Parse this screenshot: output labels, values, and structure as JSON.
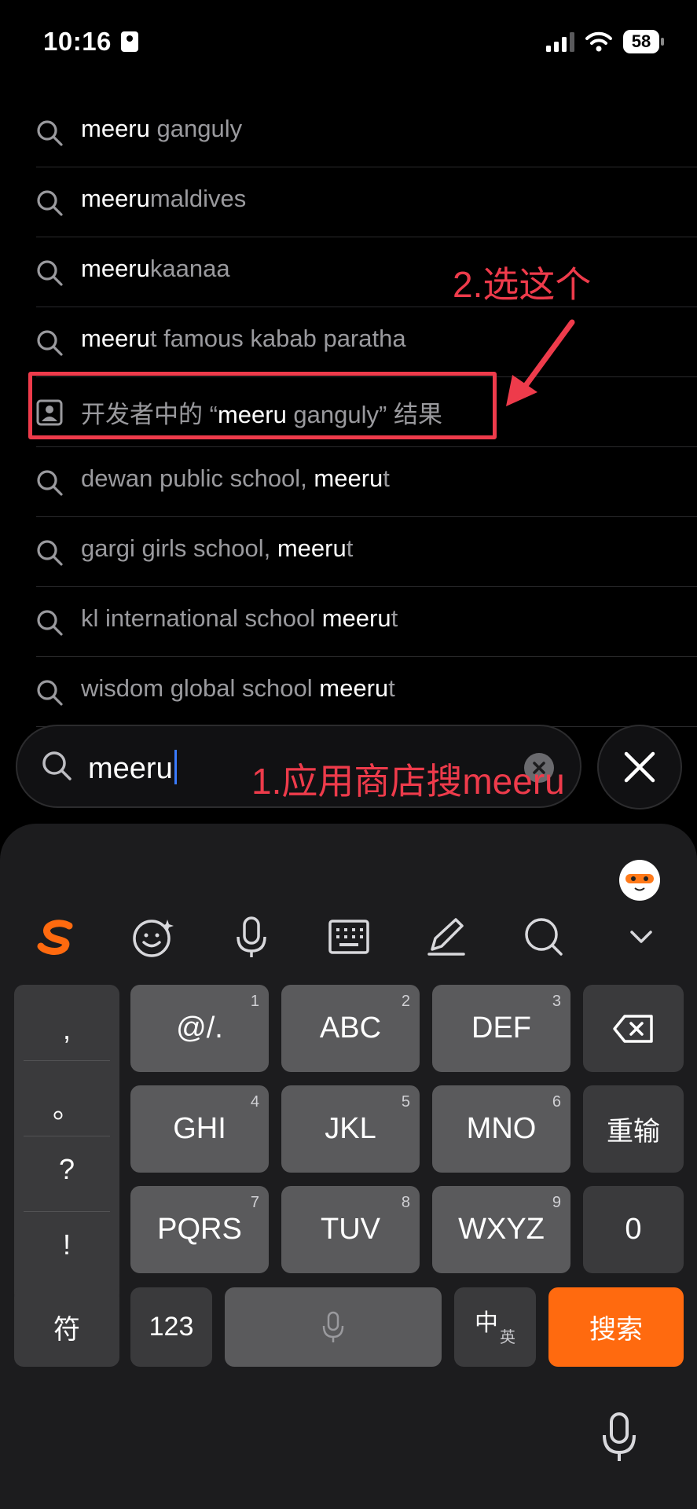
{
  "status_bar": {
    "time": "10:16",
    "battery": "58"
  },
  "suggestions": [
    {
      "hl": "meeru",
      "rest": " ganguly",
      "order": "hl-first"
    },
    {
      "hl": "meeru",
      "rest": "maldives",
      "order": "hl-first"
    },
    {
      "hl": "meeru",
      "rest": "kaanaa",
      "order": "hl-first"
    },
    {
      "hl": "meeru",
      "rest": "t famous kabab paratha",
      "order": "hl-first"
    },
    {
      "prefix": "开发者中的 “",
      "hl": "meeru",
      "rest": " ganguly” 结果",
      "type": "developer"
    },
    {
      "pre": "dewan public school, ",
      "hl": "meeru",
      "post": "t"
    },
    {
      "pre": "gargi girls school, ",
      "hl": "meeru",
      "post": "t"
    },
    {
      "pre": "kl international school ",
      "hl": "meeru",
      "post": "t"
    },
    {
      "pre": "wisdom global school ",
      "hl": "meeru",
      "post": "t"
    }
  ],
  "annotations": {
    "step2": "2.选这个",
    "step1": "1.应用商店搜meeru",
    "color": "#ee3b4b"
  },
  "search": {
    "value": "meeru"
  },
  "keyboard": {
    "toolbar": [
      "sogou-logo-icon",
      "emoji-icon",
      "voice-icon",
      "keyboard-icon",
      "handwriting-icon",
      "search-icon",
      "collapse-icon"
    ],
    "punct": [
      ",",
      "。",
      "?",
      "!"
    ],
    "keys": [
      {
        "label": "@/.",
        "num": "1"
      },
      {
        "label": "ABC",
        "num": "2"
      },
      {
        "label": "DEF",
        "num": "3"
      },
      {
        "label": "GHI",
        "num": "4"
      },
      {
        "label": "JKL",
        "num": "5"
      },
      {
        "label": "MNO",
        "num": "6"
      },
      {
        "label": "PQRS",
        "num": "7"
      },
      {
        "label": "TUV",
        "num": "8"
      },
      {
        "label": "WXYZ",
        "num": "9"
      }
    ],
    "reenter": "重输",
    "zero": "0",
    "symbols": "符",
    "numbers": "123",
    "lang_main": "中",
    "lang_sub": "英",
    "search_key": "搜索",
    "accent": "#ff6a0f"
  }
}
